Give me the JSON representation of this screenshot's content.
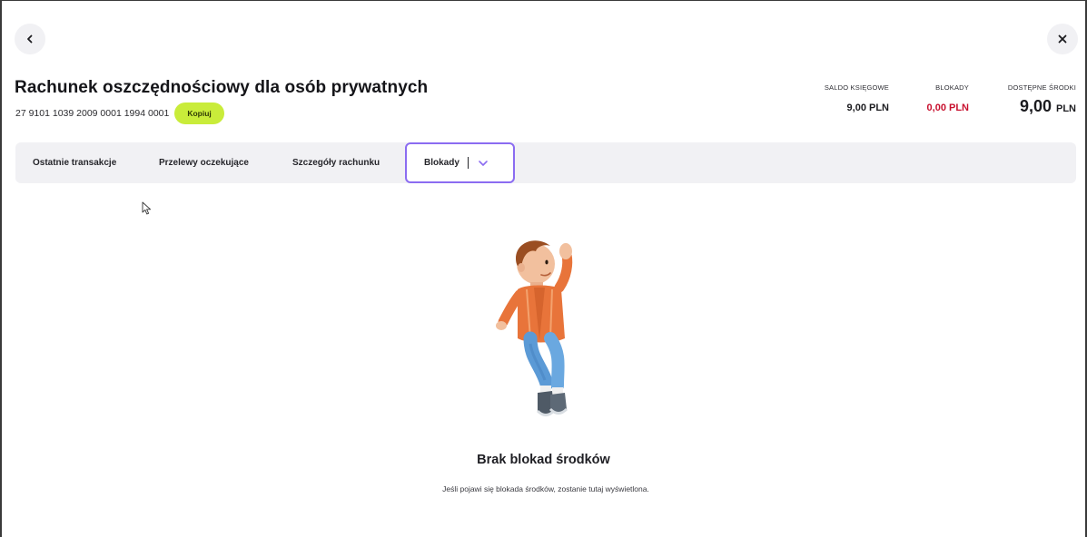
{
  "header": {
    "back_icon": "chevron-left-icon",
    "close_icon": "close-icon"
  },
  "account": {
    "title": "Rachunek oszczędnościowy dla osób prywatnych",
    "number": "27 9101 1039 2009 0001 1994 0001",
    "copy_label": "Kopiuj"
  },
  "balances": {
    "saldo_label": "SALDO KSIĘGOWE",
    "saldo_value": "9,00 PLN",
    "blokady_label": "BLOKADY",
    "blokady_value": "0,00 PLN",
    "available_label": "DOSTĘPNE ŚRODKI",
    "available_amount": "9,00",
    "available_currency": "PLN",
    "colors": {
      "blokady": "#c8102e"
    }
  },
  "tabs": [
    {
      "label": "Ostatnie transakcje"
    },
    {
      "label": "Przelewy oczekujące"
    },
    {
      "label": "Szczegóły rachunku"
    },
    {
      "label": "Blokady",
      "active": true,
      "icon": "chevron-down-icon"
    }
  ],
  "empty_state": {
    "illustration": "person-calling-illustration",
    "title": "Brak blokad środków",
    "description": "Jeśli pojawi się blokada środków, zostanie tutaj wyświetlona."
  },
  "colors": {
    "accent": "#8b6cf1",
    "copy_button": "#c9ec3a",
    "tab_bar": "#f1f1f4"
  }
}
